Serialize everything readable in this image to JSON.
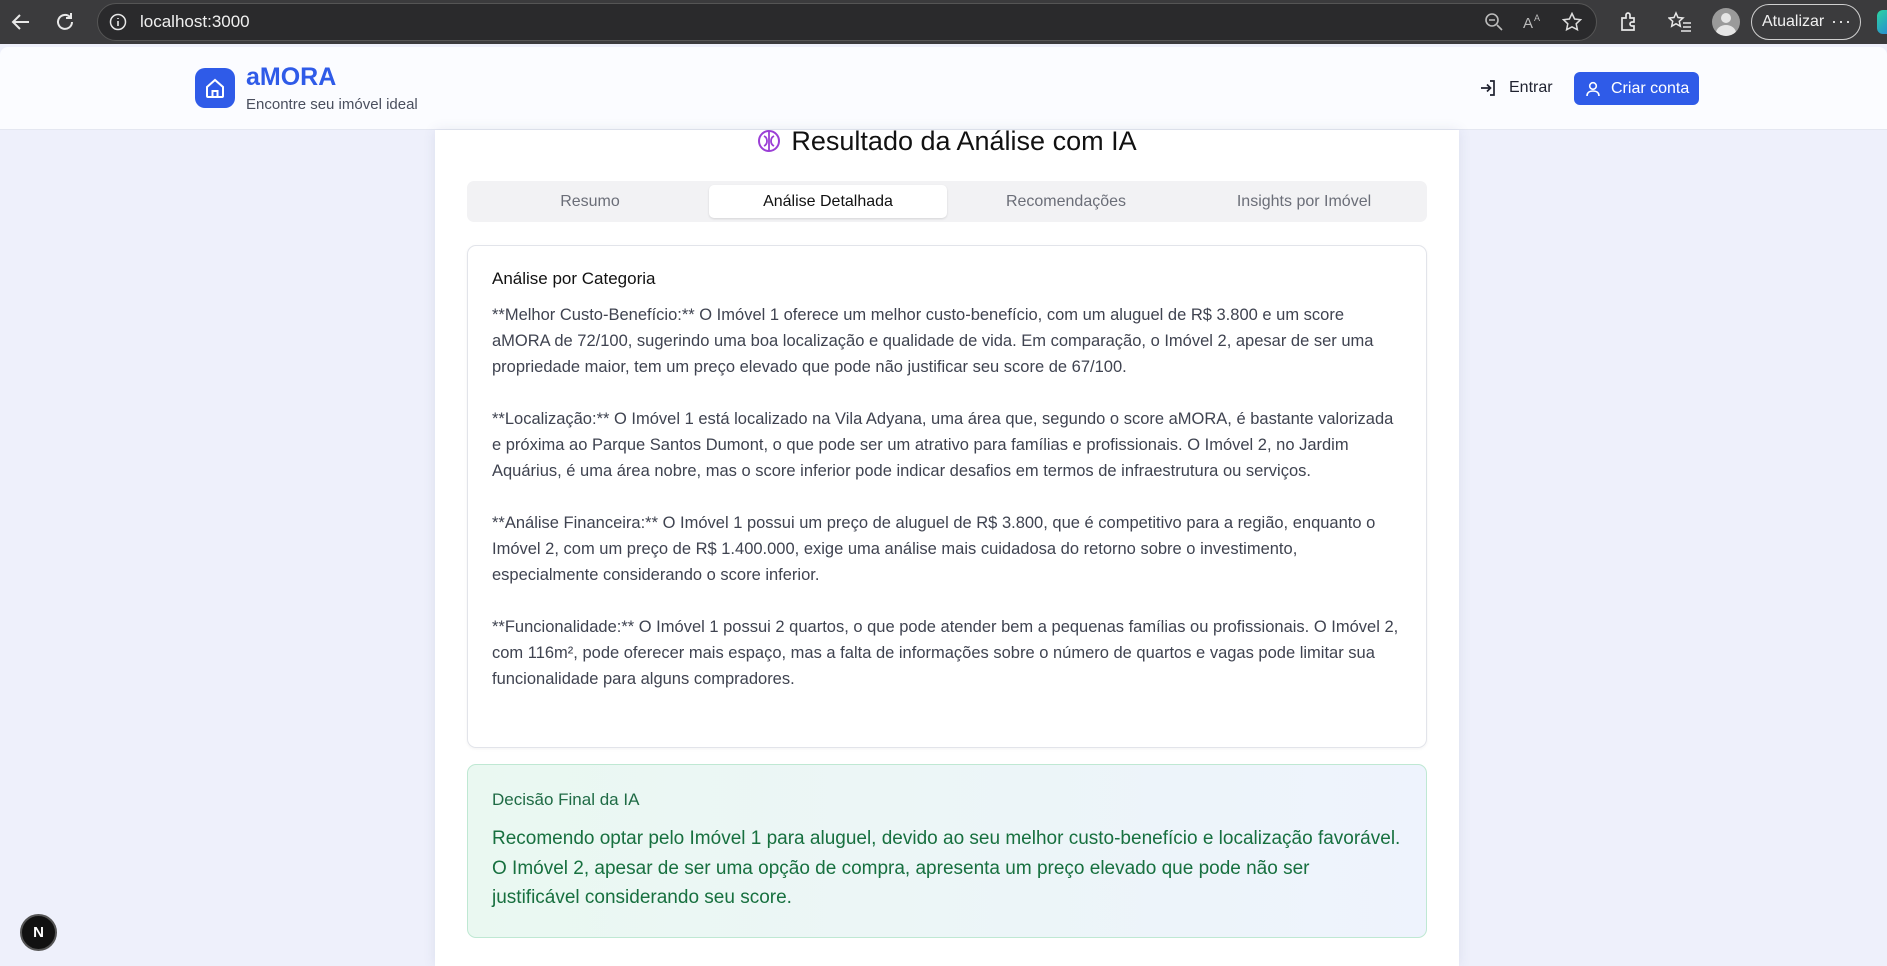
{
  "browser": {
    "url": "localhost:3000",
    "update_label": "Atualizar",
    "more_label": "···"
  },
  "header": {
    "brand": "aMORA",
    "tagline": "Encontre seu imóvel ideal",
    "login_label": "Entrar",
    "signup_label": "Criar conta"
  },
  "result": {
    "title": "Resultado da Análise com IA",
    "tabs": [
      {
        "label": "Resumo"
      },
      {
        "label": "Análise Detalhada"
      },
      {
        "label": "Recomendações"
      },
      {
        "label": "Insights por Imóvel"
      }
    ],
    "active_tab": "Análise Detalhada"
  },
  "analysis": {
    "heading": "Análise por Categoria",
    "paragraphs": [
      "**Melhor Custo-Benefício:** O Imóvel 1 oferece um melhor custo-benefício, com um aluguel de R$ 3.800 e um score aMORA de 72/100, sugerindo uma boa localização e qualidade de vida. Em comparação, o Imóvel 2, apesar de ser uma propriedade maior, tem um preço elevado que pode não justificar seu score de 67/100.",
      "**Localização:** O Imóvel 1 está localizado na Vila Adyana, uma área que, segundo o score aMORA, é bastante valorizada e próxima ao Parque Santos Dumont, o que pode ser um atrativo para famílias e profissionais. O Imóvel 2, no Jardim Aquárius, é uma área nobre, mas o score inferior pode indicar desafios em termos de infraestrutura ou serviços.",
      "**Análise Financeira:** O Imóvel 1 possui um preço de aluguel de R$ 3.800, que é competitivo para a região, enquanto o Imóvel 2, com um preço de R$ 1.400.000, exige uma análise mais cuidadosa do retorno sobre o investimento, especialmente considerando o score inferior.",
      "**Funcionalidade:** O Imóvel 1 possui 2 quartos, o que pode atender bem a pequenas famílias ou profissionais. O Imóvel 2, com 116m², pode oferecer mais espaço, mas a falta de informações sobre o número de quartos e vagas pode limitar sua funcionalidade para alguns compradores."
    ]
  },
  "decision": {
    "heading": "Decisão Final da IA",
    "text": "Recomendo optar pelo Imóvel 1 para aluguel, devido ao seu melhor custo-benefício e localização favorável. O Imóvel 2, apesar de ser uma opção de compra, apresenta um preço elevado que pode não ser justificável considerando seu score."
  },
  "dev_badge": {
    "label": "N"
  },
  "colors": {
    "brand": "#2f5be8",
    "decision_text": "#17703f",
    "chrome_bg": "#3b3b3d"
  }
}
